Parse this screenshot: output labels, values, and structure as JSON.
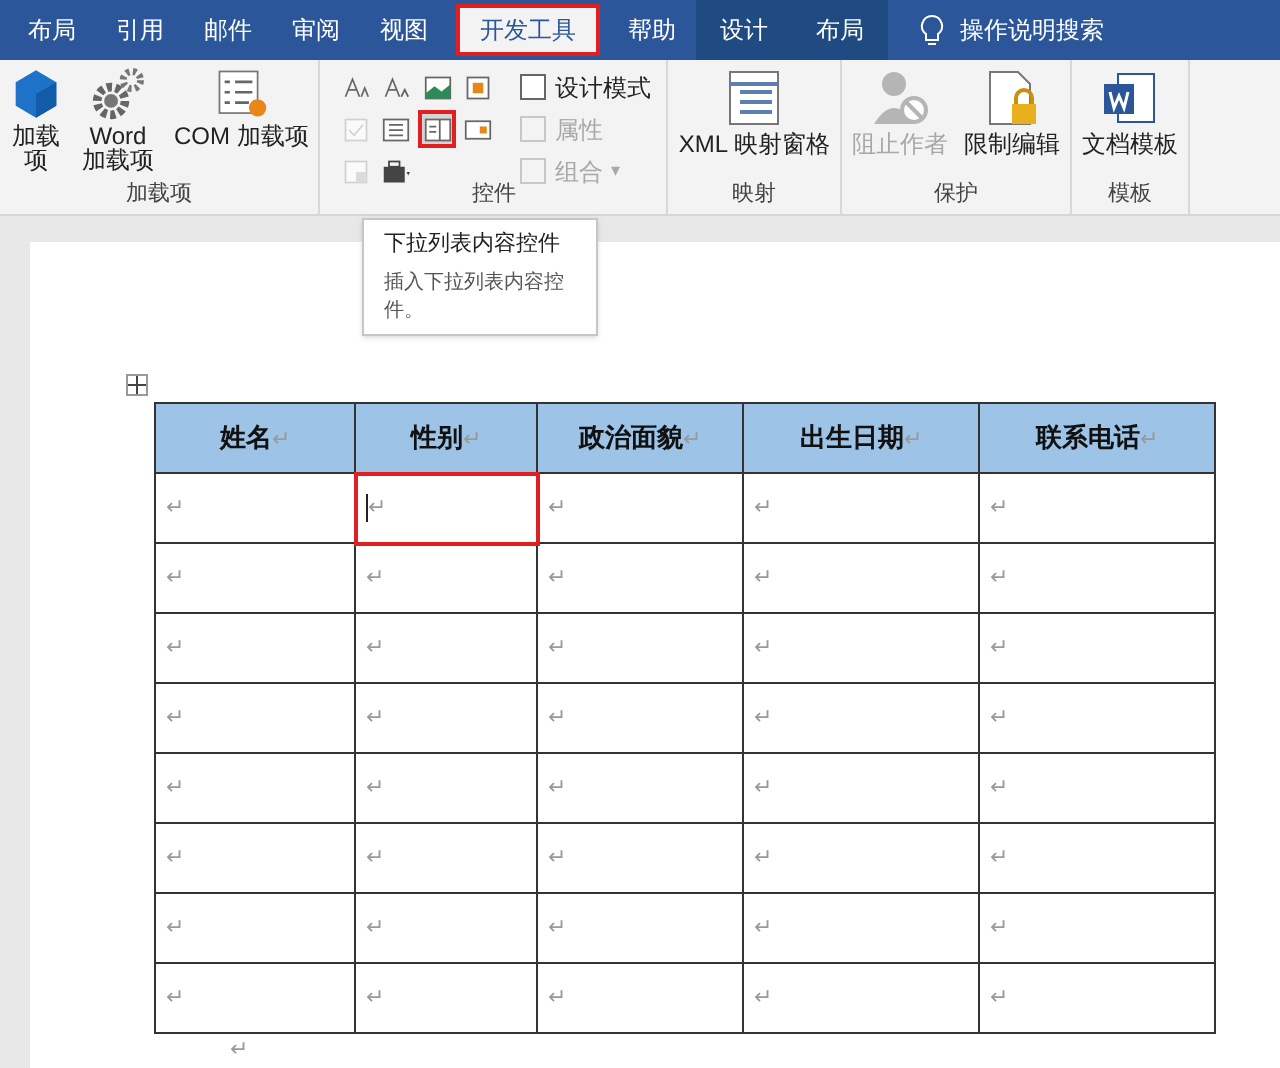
{
  "tabs": [
    {
      "label": "布局",
      "selected": false,
      "contextual": false
    },
    {
      "label": "引用",
      "selected": false,
      "contextual": false
    },
    {
      "label": "邮件",
      "selected": false,
      "contextual": false
    },
    {
      "label": "审阅",
      "selected": false,
      "contextual": false
    },
    {
      "label": "视图",
      "selected": false,
      "contextual": false
    },
    {
      "label": "开发工具",
      "selected": true,
      "contextual": false
    },
    {
      "label": "帮助",
      "selected": false,
      "contextual": false
    },
    {
      "label": "设计",
      "selected": false,
      "contextual": true
    },
    {
      "label": "布局",
      "selected": false,
      "contextual": true
    }
  ],
  "search": {
    "label": "操作说明搜索"
  },
  "ribbon": {
    "groups": [
      {
        "label": "加载项",
        "kind": "large",
        "items": [
          {
            "label": "加载项",
            "disabled": false
          },
          {
            "label": "Word 加载项",
            "disabled": false
          },
          {
            "label": "COM 加载项",
            "disabled": false
          }
        ]
      },
      {
        "label": "控件",
        "kind": "controls",
        "icon_buttons": [
          {
            "highlighted": false,
            "disabled": false
          },
          {
            "highlighted": false,
            "disabled": false
          },
          {
            "highlighted": false,
            "disabled": false
          },
          {
            "highlighted": false,
            "disabled": false
          },
          {
            "highlighted": false,
            "disabled": true
          },
          {
            "highlighted": false,
            "disabled": false
          },
          {
            "highlighted": true,
            "disabled": false
          },
          {
            "highlighted": false,
            "disabled": false
          },
          {
            "highlighted": false,
            "disabled": true
          },
          {
            "highlighted": false,
            "disabled": false
          }
        ],
        "items": [
          {
            "label": "设计模式",
            "disabled": false
          },
          {
            "label": "属性",
            "disabled": true
          },
          {
            "label": "组合",
            "disabled": true,
            "caret": "▾"
          }
        ]
      },
      {
        "label": "映射",
        "kind": "large",
        "items": [
          {
            "label": "XML 映射窗格",
            "disabled": false
          }
        ]
      },
      {
        "label": "保护",
        "kind": "large",
        "items": [
          {
            "label": "阻止作者",
            "disabled": true
          },
          {
            "label": "限制编辑",
            "disabled": false
          }
        ]
      },
      {
        "label": "模板",
        "kind": "large",
        "items": [
          {
            "label": "文档模板",
            "disabled": false
          }
        ]
      }
    ]
  },
  "tooltip": {
    "title": "下拉列表内容控件",
    "body": "插入下拉列表内容控件。"
  },
  "table": {
    "columns": [
      {
        "label": "姓名",
        "mark": "↵"
      },
      {
        "label": "性别",
        "mark": "↵"
      },
      {
        "label": "政治面貌",
        "mark": "↵"
      },
      {
        "label": "出生日期",
        "mark": "↵"
      },
      {
        "label": "联系电话",
        "mark": "↵"
      }
    ],
    "rows": [
      [
        {
          "text": "↵",
          "highlighted": false,
          "cursor": false
        },
        {
          "text": "↵",
          "highlighted": true,
          "cursor": true
        },
        {
          "text": "↵",
          "highlighted": false,
          "cursor": false
        },
        {
          "text": "↵",
          "highlighted": false,
          "cursor": false
        },
        {
          "text": "↵",
          "highlighted": false,
          "cursor": false
        }
      ],
      [
        {
          "text": "↵",
          "highlighted": false,
          "cursor": false
        },
        {
          "text": "↵",
          "highlighted": false,
          "cursor": false
        },
        {
          "text": "↵",
          "highlighted": false,
          "cursor": false
        },
        {
          "text": "↵",
          "highlighted": false,
          "cursor": false
        },
        {
          "text": "↵",
          "highlighted": false,
          "cursor": false
        }
      ],
      [
        {
          "text": "↵",
          "highlighted": false,
          "cursor": false
        },
        {
          "text": "↵",
          "highlighted": false,
          "cursor": false
        },
        {
          "text": "↵",
          "highlighted": false,
          "cursor": false
        },
        {
          "text": "↵",
          "highlighted": false,
          "cursor": false
        },
        {
          "text": "↵",
          "highlighted": false,
          "cursor": false
        }
      ],
      [
        {
          "text": "↵",
          "highlighted": false,
          "cursor": false
        },
        {
          "text": "↵",
          "highlighted": false,
          "cursor": false
        },
        {
          "text": "↵",
          "highlighted": false,
          "cursor": false
        },
        {
          "text": "↵",
          "highlighted": false,
          "cursor": false
        },
        {
          "text": "↵",
          "highlighted": false,
          "cursor": false
        }
      ],
      [
        {
          "text": "↵",
          "highlighted": false,
          "cursor": false
        },
        {
          "text": "↵",
          "highlighted": false,
          "cursor": false
        },
        {
          "text": "↵",
          "highlighted": false,
          "cursor": false
        },
        {
          "text": "↵",
          "highlighted": false,
          "cursor": false
        },
        {
          "text": "↵",
          "highlighted": false,
          "cursor": false
        }
      ],
      [
        {
          "text": "↵",
          "highlighted": false,
          "cursor": false
        },
        {
          "text": "↵",
          "highlighted": false,
          "cursor": false
        },
        {
          "text": "↵",
          "highlighted": false,
          "cursor": false
        },
        {
          "text": "↵",
          "highlighted": false,
          "cursor": false
        },
        {
          "text": "↵",
          "highlighted": false,
          "cursor": false
        }
      ],
      [
        {
          "text": "↵",
          "highlighted": false,
          "cursor": false
        },
        {
          "text": "↵",
          "highlighted": false,
          "cursor": false
        },
        {
          "text": "↵",
          "highlighted": false,
          "cursor": false
        },
        {
          "text": "↵",
          "highlighted": false,
          "cursor": false
        },
        {
          "text": "↵",
          "highlighted": false,
          "cursor": false
        }
      ],
      [
        {
          "text": "↵",
          "highlighted": false,
          "cursor": false
        },
        {
          "text": "↵",
          "highlighted": false,
          "cursor": false
        },
        {
          "text": "↵",
          "highlighted": false,
          "cursor": false
        },
        {
          "text": "↵",
          "highlighted": false,
          "cursor": false
        },
        {
          "text": "↵",
          "highlighted": false,
          "cursor": false
        }
      ]
    ]
  },
  "after_table": {
    "text": "↵"
  }
}
